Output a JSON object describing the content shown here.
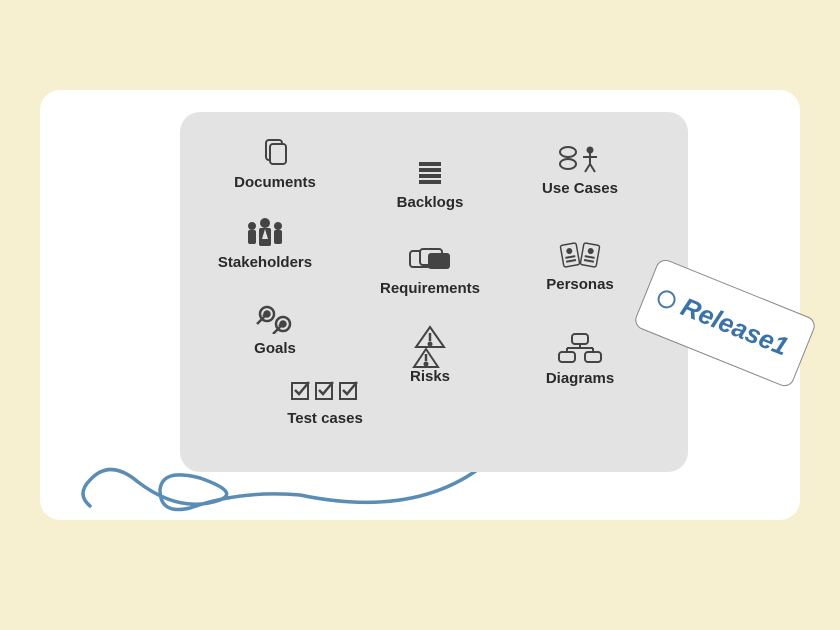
{
  "items": {
    "documents": "Documents",
    "backlogs": "Backlogs",
    "usecases": "Use Cases",
    "stakeholders": "Stakeholders",
    "requirements": "Requirements",
    "personas": "Personas",
    "goals": "Goals",
    "testcases": "Test cases",
    "risks": "Risks",
    "diagrams": "Diagrams"
  },
  "tag": {
    "label": "Release1"
  }
}
